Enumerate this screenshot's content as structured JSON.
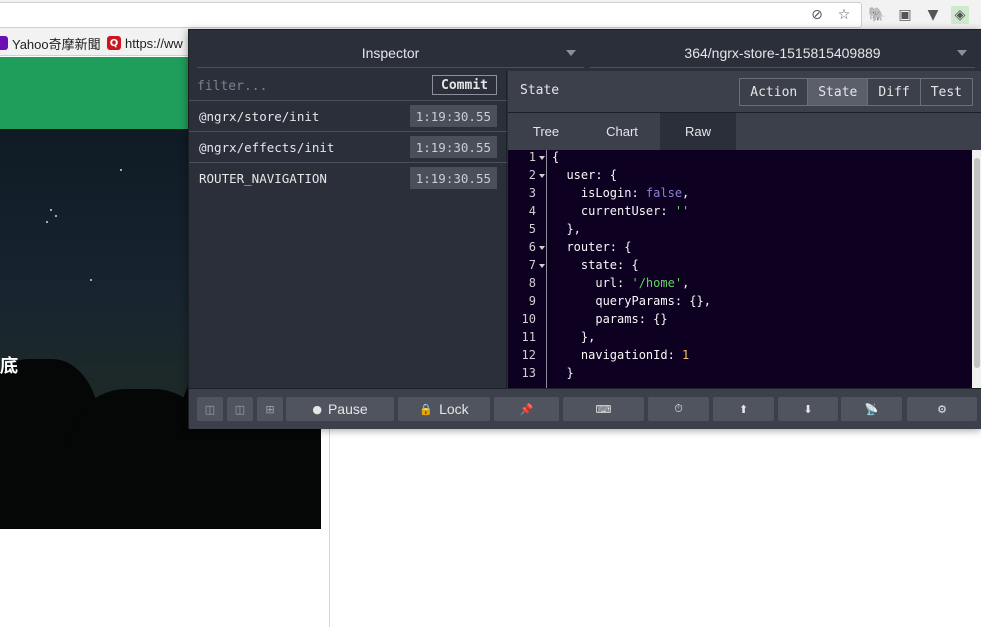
{
  "browser": {
    "bookmarks": [
      {
        "label": "Yahoo奇摩新聞",
        "fav_color": "#6b0fb3",
        "icon": "yahoo-favicon"
      },
      {
        "label": "https://ww",
        "fav_color": "#d0141f",
        "fav_glyph": "Q",
        "icon": "q-favicon"
      }
    ],
    "toolbar_icons": [
      "translate-icon",
      "star-icon",
      "evernote-icon",
      "extension-icon",
      "vue-icon",
      "redux-devtools-icon"
    ]
  },
  "page": {
    "hero_text": "底"
  },
  "devtools": {
    "monitor_select": "Inspector",
    "instance_select": "364/ngrx-store-1515815409889",
    "filter_placeholder": "filter...",
    "commit_label": "Commit",
    "actions": [
      {
        "name": "@ngrx/store/init",
        "time": "1:19:30.55"
      },
      {
        "name": "@ngrx/effects/init",
        "time": "1:19:30.55"
      },
      {
        "name": "ROUTER_NAVIGATION",
        "time": "1:19:30.55"
      }
    ],
    "state_title": "State",
    "tabs": [
      "Action",
      "State",
      "Diff",
      "Test"
    ],
    "active_tab": "State",
    "subtabs": [
      "Tree",
      "Chart",
      "Raw"
    ],
    "active_subtab": "Raw",
    "code_lines": [
      {
        "n": "1",
        "fold": true,
        "parts": [
          [
            "p",
            "{"
          ]
        ]
      },
      {
        "n": "2",
        "fold": true,
        "parts": [
          [
            "p",
            "  user: {"
          ]
        ]
      },
      {
        "n": "3",
        "fold": false,
        "parts": [
          [
            "p",
            "    isLogin: "
          ],
          [
            "b",
            "false"
          ],
          [
            "p",
            ","
          ]
        ]
      },
      {
        "n": "4",
        "fold": false,
        "parts": [
          [
            "p",
            "    currentUser: "
          ],
          [
            "s",
            "''"
          ]
        ]
      },
      {
        "n": "5",
        "fold": false,
        "parts": [
          [
            "p",
            "  },"
          ]
        ]
      },
      {
        "n": "6",
        "fold": true,
        "parts": [
          [
            "p",
            "  router: {"
          ]
        ]
      },
      {
        "n": "7",
        "fold": true,
        "parts": [
          [
            "p",
            "    state: {"
          ]
        ]
      },
      {
        "n": "8",
        "fold": false,
        "parts": [
          [
            "p",
            "      url: "
          ],
          [
            "s",
            "'/home'"
          ],
          [
            "p",
            ","
          ]
        ]
      },
      {
        "n": "9",
        "fold": false,
        "parts": [
          [
            "p",
            "      queryParams: {},"
          ]
        ]
      },
      {
        "n": "10",
        "fold": false,
        "parts": [
          [
            "p",
            "      params: {}"
          ]
        ]
      },
      {
        "n": "11",
        "fold": false,
        "parts": [
          [
            "p",
            "    },"
          ]
        ]
      },
      {
        "n": "12",
        "fold": false,
        "parts": [
          [
            "p",
            "    navigationId: "
          ],
          [
            "n",
            "1"
          ]
        ]
      },
      {
        "n": "13",
        "fold": false,
        "parts": [
          [
            "p",
            "  }"
          ]
        ]
      }
    ],
    "bottom": {
      "pause_label": "Pause",
      "lock_label": "Lock"
    },
    "colors": {
      "bool": "#8a82d8",
      "string": "#5fd35f",
      "number": "#f5c16c",
      "header_green": "#1f9d5a"
    }
  }
}
